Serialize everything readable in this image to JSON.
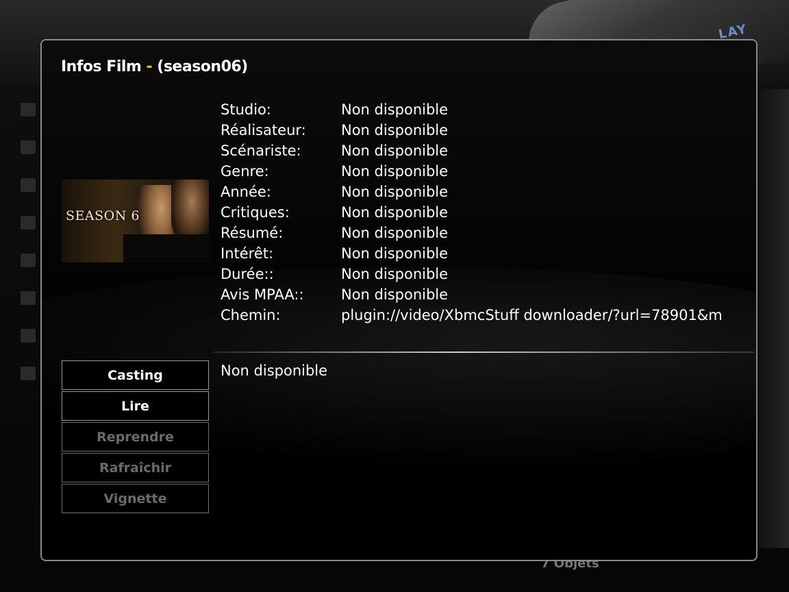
{
  "background": {
    "device_label": "LAY",
    "item_count": "7 Objets"
  },
  "dialog": {
    "title_main": "Infos Film",
    "title_sep": " - ",
    "title_item": "(season06)",
    "thumbnail": {
      "text": "SEASON 6"
    },
    "details": [
      {
        "label": "Studio:",
        "value": "Non disponible"
      },
      {
        "label": "Réalisateur:",
        "value": "Non disponible"
      },
      {
        "label": "Scénariste:",
        "value": "Non disponible"
      },
      {
        "label": "Genre:",
        "value": "Non disponible"
      },
      {
        "label": "Année:",
        "value": "Non disponible"
      },
      {
        "label": "Critiques:",
        "value": "Non disponible"
      },
      {
        "label": "Résumé:",
        "value": "Non disponible"
      },
      {
        "label": "Intérêt:",
        "value": "Non disponible"
      },
      {
        "label": "Durée::",
        "value": "Non disponible"
      },
      {
        "label": "Avis MPAA::",
        "value": "Non disponible"
      },
      {
        "label": "Chemin:",
        "value": "plugin://video/XbmcStuff downloader/?url=78901&m"
      }
    ],
    "buttons": [
      {
        "label": "Casting",
        "enabled": true
      },
      {
        "label": "Lire",
        "enabled": true
      },
      {
        "label": "Reprendre",
        "enabled": false
      },
      {
        "label": "Rafraîchir",
        "enabled": false
      },
      {
        "label": "Vignette",
        "enabled": false
      }
    ],
    "plot_text": "Non disponible"
  },
  "colors": {
    "title_separator": "#e8c21a",
    "disabled_text": "#6b6b6b"
  }
}
